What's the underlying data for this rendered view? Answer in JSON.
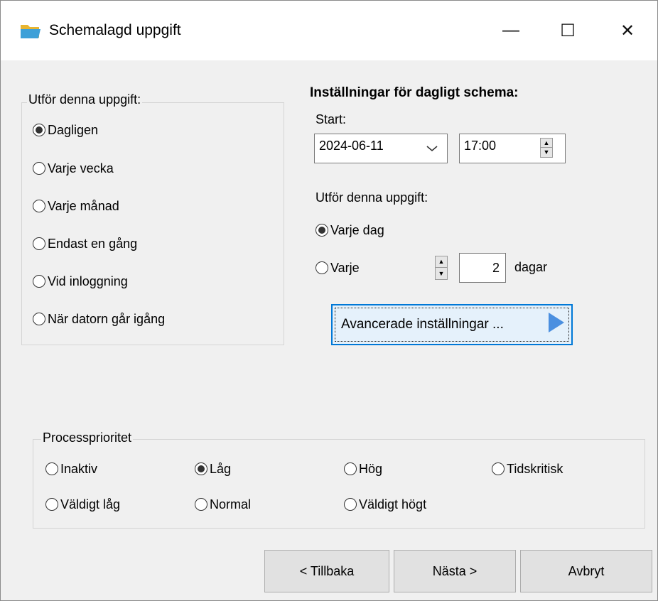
{
  "window": {
    "title": "Schemalagd uppgift",
    "minimize_glyph": "—",
    "maximize_glyph": "☐",
    "close_glyph": "✕"
  },
  "frequency": {
    "label": "Utför denna uppgift:",
    "options": [
      {
        "label": "Dagligen",
        "checked": true
      },
      {
        "label": "Varje vecka",
        "checked": false
      },
      {
        "label": "Varje månad",
        "checked": false
      },
      {
        "label": "Endast en gång",
        "checked": false
      },
      {
        "label": "Vid inloggning",
        "checked": false
      },
      {
        "label": "När datorn går igång",
        "checked": false
      }
    ]
  },
  "daily": {
    "heading": "Inställningar för dagligt schema:",
    "start_label": "Start:",
    "date_value": "2024-06-11",
    "time_value": "17:00",
    "perform_label": "Utför denna uppgift:",
    "every_day_label": "Varje dag",
    "every_day_checked": true,
    "every_label": "Varje",
    "every_checked": false,
    "interval_value": "2",
    "interval_unit": "dagar",
    "advanced_label": "Avancerade inställningar ..."
  },
  "priority": {
    "label": "Processprioritet",
    "options": [
      {
        "label": "Inaktiv",
        "checked": false
      },
      {
        "label": "Låg",
        "checked": true
      },
      {
        "label": "Hög",
        "checked": false
      },
      {
        "label": "Tidskritisk",
        "checked": false
      },
      {
        "label": "Väldigt låg",
        "checked": false
      },
      {
        "label": "Normal",
        "checked": false
      },
      {
        "label": "Väldigt högt",
        "checked": false
      }
    ]
  },
  "footer": {
    "back_label": "< Tillbaka",
    "next_label": "Nästa >",
    "cancel_label": "Avbryt"
  }
}
